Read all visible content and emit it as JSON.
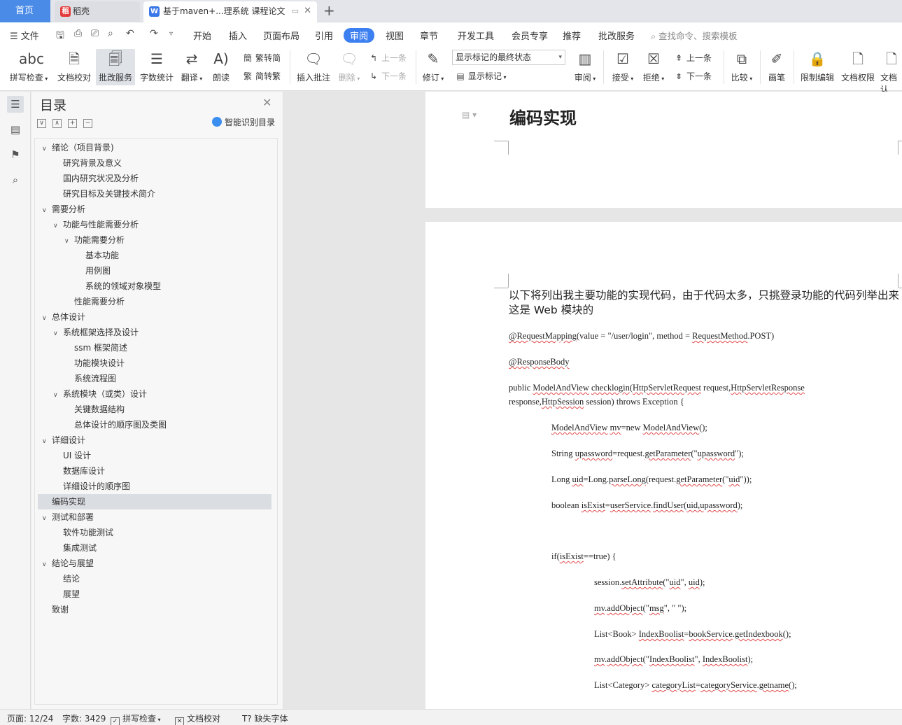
{
  "tabs": {
    "home": "首页",
    "daoke": "稻壳",
    "doc": "基于maven+...理系统 课程论文"
  },
  "menu": {
    "file": "文件",
    "items": [
      "开始",
      "插入",
      "页面布局",
      "引用",
      "审阅",
      "视图",
      "章节",
      "开发工具",
      "会员专享",
      "推荐",
      "批改服务"
    ],
    "active": "审阅",
    "search": "查找命令、搜索模板"
  },
  "ribbon": {
    "spell": "拼写检查",
    "proof": "文档校对",
    "correct": "批改服务",
    "count": "字数统计",
    "translate": "翻译",
    "read": "朗读",
    "t2s": "繁转简",
    "s2t": "简转繁",
    "insert_comment": "插入批注",
    "delete": "删除",
    "prev": "上一条",
    "next": "下一条",
    "revise": "修订",
    "markup_state": "显示标记的最终状态",
    "show_markup": "显示标记",
    "review": "审阅",
    "accept": "接受",
    "reject": "拒绝",
    "prev2": "上一条",
    "next2": "下一条",
    "compare": "比较",
    "pen": "画笔",
    "restrict": "限制编辑",
    "perm": "文档权限",
    "more": "文档认"
  },
  "toc": {
    "title": "目录",
    "smart": "智能识别目录",
    "items": [
      {
        "label": "绪论（项目背景)",
        "level": 0,
        "toggle": "∨"
      },
      {
        "label": "研究背景及意义",
        "level": 1,
        "toggle": ""
      },
      {
        "label": "国内研究状况及分析",
        "level": 1,
        "toggle": ""
      },
      {
        "label": "研究目标及关键技术简介",
        "level": 1,
        "toggle": ""
      },
      {
        "label": "需要分析",
        "level": 0,
        "toggle": "∨"
      },
      {
        "label": "功能与性能需要分析",
        "level": 1,
        "toggle": "∨"
      },
      {
        "label": "功能需要分析",
        "level": 2,
        "toggle": "∨"
      },
      {
        "label": "基本功能",
        "level": 3,
        "toggle": ""
      },
      {
        "label": "用例图",
        "level": 3,
        "toggle": ""
      },
      {
        "label": "系统的领域对象模型",
        "level": 3,
        "toggle": ""
      },
      {
        "label": "性能需要分析",
        "level": 2,
        "toggle": ""
      },
      {
        "label": "总体设计",
        "level": 0,
        "toggle": "∨"
      },
      {
        "label": "系统框架选择及设计",
        "level": 1,
        "toggle": "∨"
      },
      {
        "label": "ssm 框架简述",
        "level": 2,
        "toggle": ""
      },
      {
        "label": "功能模块设计",
        "level": 2,
        "toggle": ""
      },
      {
        "label": "系统流程图",
        "level": 2,
        "toggle": ""
      },
      {
        "label": "系统模块（或类）设计",
        "level": 1,
        "toggle": "∨"
      },
      {
        "label": "关键数据结构",
        "level": 2,
        "toggle": ""
      },
      {
        "label": "总体设计的顺序图及类图",
        "level": 2,
        "toggle": ""
      },
      {
        "label": "详细设计",
        "level": 0,
        "toggle": "∨"
      },
      {
        "label": "UI 设计",
        "level": 1,
        "toggle": ""
      },
      {
        "label": "数据库设计",
        "level": 1,
        "toggle": ""
      },
      {
        "label": "详细设计的顺序图",
        "level": 1,
        "toggle": ""
      },
      {
        "label": "编码实现",
        "level": 0,
        "toggle": "",
        "current": true
      },
      {
        "label": "测试和部署",
        "level": 0,
        "toggle": "∨"
      },
      {
        "label": "软件功能测试",
        "level": 1,
        "toggle": ""
      },
      {
        "label": "集成测试",
        "level": 1,
        "toggle": ""
      },
      {
        "label": "结论与展望",
        "level": 0,
        "toggle": "∨"
      },
      {
        "label": "结论",
        "level": 1,
        "toggle": ""
      },
      {
        "label": "展望",
        "level": 1,
        "toggle": ""
      },
      {
        "label": "致谢",
        "level": 0,
        "toggle": ""
      }
    ]
  },
  "doc": {
    "heading": "编码实现",
    "intro": "以下将列出我主要功能的实现代码，由于代码太多，只挑登录功能的代码列举出来  这是  Web  模块的",
    "code_lines": [
      "@RequestMapping(value = \"/user/login\", method = RequestMethod.POST)",
      "@ResponseBody",
      "public ModelAndView checklogin(HttpServletRequest request,HttpServletResponse",
      "response,HttpSession session) throws Exception {",
      "ModelAndView mv=new ModelAndView();",
      "String upassword=request.getParameter(\"upassword\");",
      "Long uid=Long.parseLong(request.getParameter(\"uid\"));",
      "boolean isExist=userService.findUser(uid,upassword);",
      "if(isExist==true) {",
      "session.setAttribute(\"uid\", uid);",
      "mv.addObject(\"msg\", \" \");",
      "List<Book> IndexBoolist=bookService.getIndexbook();",
      "mv.addObject(\"IndexBoolist\", IndexBoolist);",
      "List<Category> categoryList=categoryService.getname();"
    ]
  },
  "status": {
    "page": "页面: 12/24",
    "words": "字数: 3429",
    "spell": "拼写检查",
    "proof": "文档校对",
    "font": "缺失字体"
  }
}
